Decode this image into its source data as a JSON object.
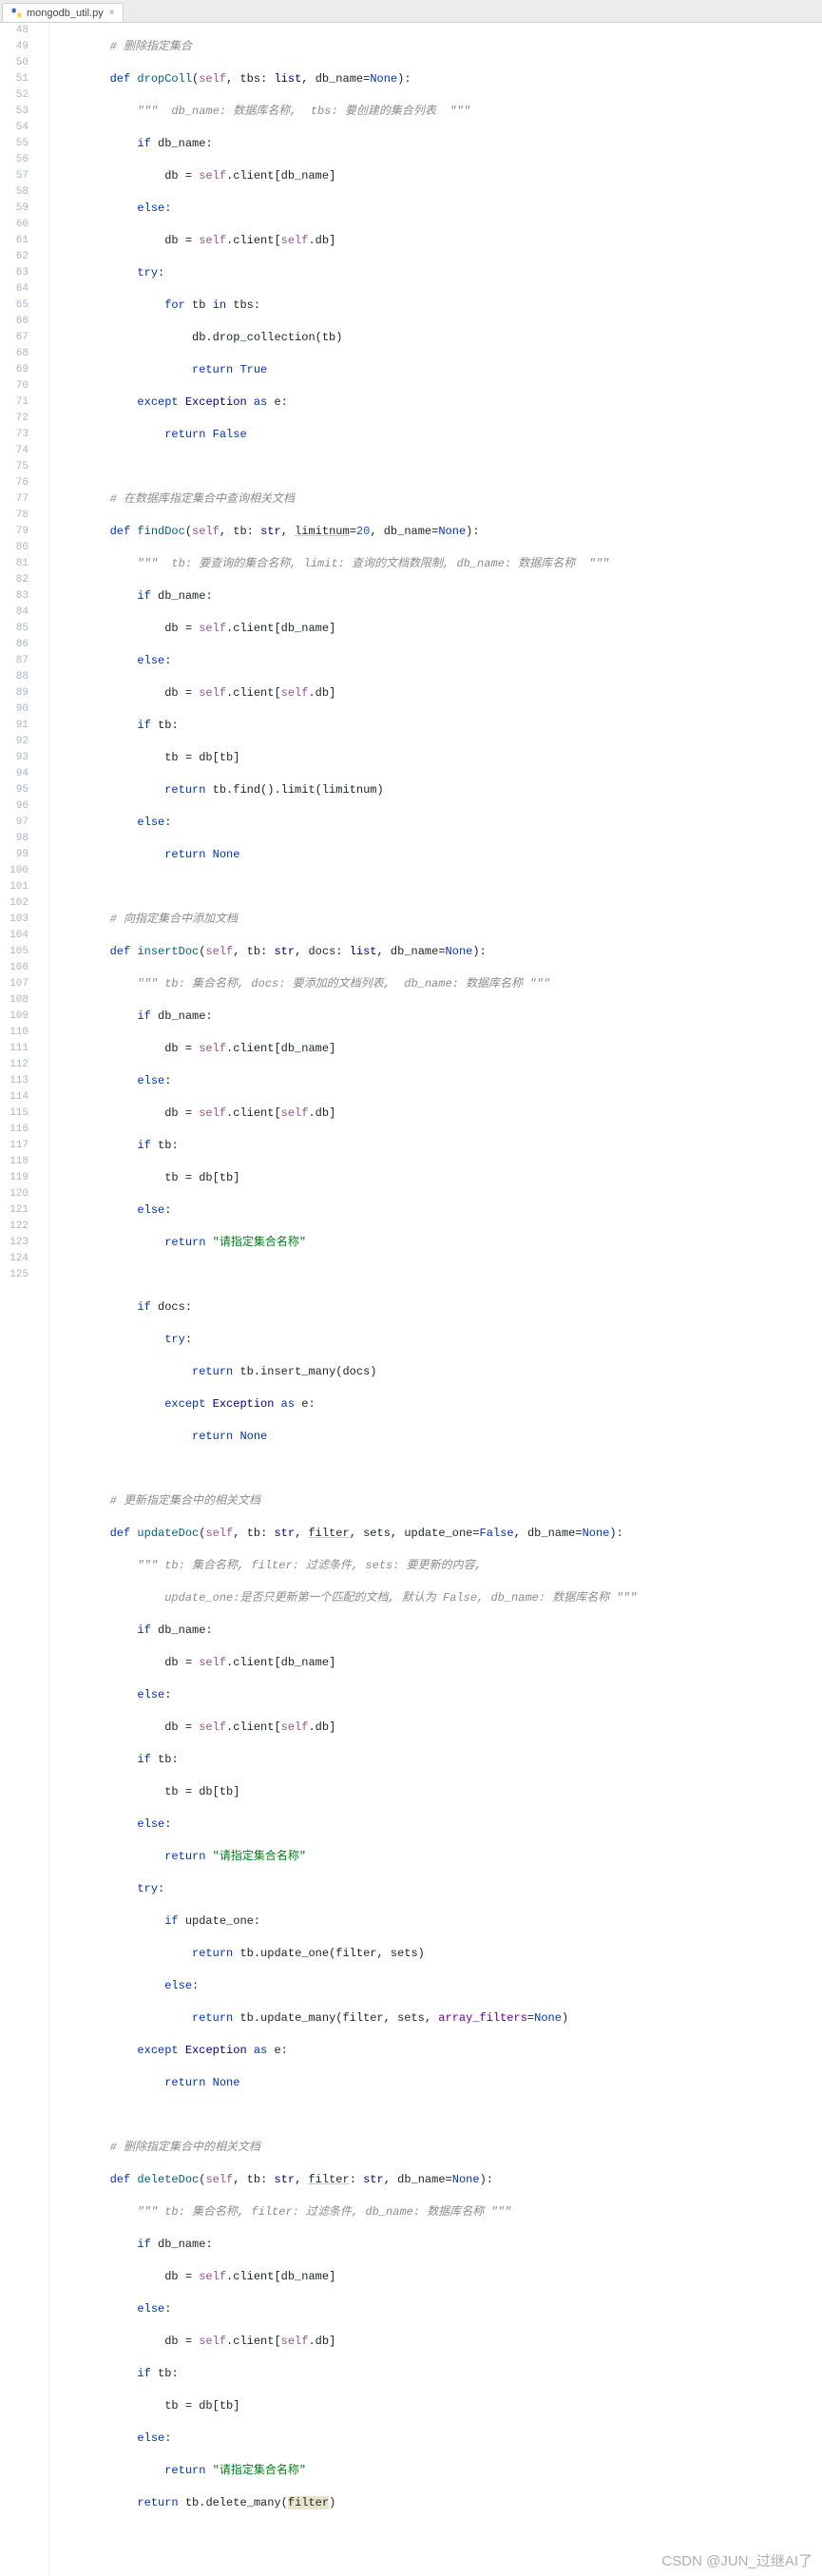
{
  "tab": {
    "filename": "mongodb_util.py",
    "close": "×"
  },
  "gutter": {
    "start": 48,
    "end": 125
  },
  "watermark": "CSDN @JUN_过继AI了",
  "code": {
    "l48": {
      "comment": "# 删除指定集合"
    },
    "l49": {
      "kw1": "def",
      "name": "dropColl",
      "self": "self",
      "p1": "tbs",
      "t1": "list",
      "p2": "db_name",
      "none": "None"
    },
    "l50": {
      "doc": "\"\"\"  db_name: 数据库名称,  tbs: 要创建的集合列表  \"\"\""
    },
    "l51": {
      "kw": "if",
      "id": "db_name"
    },
    "l52": {
      "id1": "db",
      "self": "self",
      "id2": ".client[db_name]"
    },
    "l53": {
      "kw": "else"
    },
    "l54": {
      "id1": "db",
      "self1": "self",
      "mid": ".client[",
      "self2": "self",
      "end": ".db]"
    },
    "l55": {
      "kw": "try"
    },
    "l56": {
      "kw1": "for",
      "id": "tb",
      "kw2": "in",
      "id2": "tbs"
    },
    "l57": {
      "txt": "db.drop_collection(tb)"
    },
    "l58": {
      "kw": "return",
      "val": "True"
    },
    "l59": {
      "kw1": "except",
      "exc": "Exception",
      "kw2": "as",
      "id": "e"
    },
    "l60": {
      "kw": "return",
      "val": "False"
    },
    "l62": {
      "comment": "# 在数据库指定集合中查询相关文档"
    },
    "l63": {
      "kw": "def",
      "name": "findDoc",
      "self": "self",
      "p1": "tb",
      "t1": "str",
      "p2": "limitnum",
      "v2": "20",
      "p3": "db_name",
      "none": "None"
    },
    "l64": {
      "doc": "\"\"\"  tb: 要查询的集合名称, limit: 查询的文档数限制, db_name: 数据库名称  \"\"\""
    },
    "l65": {
      "kw": "if",
      "id": "db_name"
    },
    "l66": {
      "id1": "db",
      "self": "self",
      "rest": ".client[db_name]"
    },
    "l67": {
      "kw": "else"
    },
    "l68": {
      "id1": "db",
      "self1": "self",
      "mid": ".client[",
      "self2": "self",
      "end": ".db]"
    },
    "l69": {
      "kw": "if",
      "id": "tb"
    },
    "l70": {
      "txt": "tb = db[tb]"
    },
    "l71": {
      "kw": "return",
      "txt": "tb.find().limit(limitnum)"
    },
    "l72": {
      "kw": "else"
    },
    "l73": {
      "kw": "return",
      "val": "None"
    },
    "l75": {
      "comment": "# 向指定集合中添加文档"
    },
    "l76": {
      "kw": "def",
      "name": "insertDoc",
      "self": "self",
      "p1": "tb",
      "t1": "str",
      "p2": "docs",
      "t2": "list",
      "p3": "db_name",
      "none": "None"
    },
    "l77": {
      "doc": "\"\"\" tb: 集合名称, docs: 要添加的文档列表,  db_name: 数据库名称 \"\"\""
    },
    "l78": {
      "kw": "if",
      "id": "db_name"
    },
    "l79": {
      "id1": "db",
      "self": "self",
      "rest": ".client[db_name]"
    },
    "l80": {
      "kw": "else"
    },
    "l81": {
      "id1": "db",
      "self1": "self",
      "mid": ".client[",
      "self2": "self",
      "end": ".db]"
    },
    "l82": {
      "kw": "if",
      "id": "tb"
    },
    "l83": {
      "txt": "tb = db[tb]"
    },
    "l84": {
      "kw": "else"
    },
    "l85": {
      "kw": "return",
      "str": "\"请指定集合名称\""
    },
    "l87": {
      "kw": "if",
      "id": "docs"
    },
    "l88": {
      "kw": "try"
    },
    "l89": {
      "kw": "return",
      "txt": "tb.insert_many(docs)"
    },
    "l90": {
      "kw1": "except",
      "exc": "Exception",
      "kw2": "as",
      "id": "e"
    },
    "l91": {
      "kw": "return",
      "val": "None"
    },
    "l93": {
      "comment": "# 更新指定集合中的相关文档"
    },
    "l94": {
      "kw": "def",
      "name": "updateDoc",
      "self": "self",
      "p1": "tb",
      "t1": "str",
      "p2": "filter",
      "p3": "sets",
      "p4": "update_one",
      "v4": "False",
      "p5": "db_name",
      "none": "None"
    },
    "l95": {
      "doc": "\"\"\" tb: 集合名称, filter: 过滤条件, sets: 要更新的内容,"
    },
    "l96": {
      "doc": "    update_one:是否只更新第一个匹配的文档, 默认为 False, db_name: 数据库名称 \"\"\""
    },
    "l97": {
      "kw": "if",
      "id": "db_name"
    },
    "l98": {
      "id1": "db",
      "self": "self",
      "rest": ".client[db_name]"
    },
    "l99": {
      "kw": "else"
    },
    "l100": {
      "id1": "db",
      "self1": "self",
      "mid": ".client[",
      "self2": "self",
      "end": ".db]"
    },
    "l101": {
      "kw": "if",
      "id": "tb"
    },
    "l102": {
      "txt": "tb = db[tb]"
    },
    "l103": {
      "kw": "else"
    },
    "l104": {
      "kw": "return",
      "str": "\"请指定集合名称\""
    },
    "l105": {
      "kw": "try"
    },
    "l106": {
      "kw": "if",
      "id": "update_one"
    },
    "l107": {
      "kw": "return",
      "txt": "tb.update_one(filter, sets)"
    },
    "l108": {
      "kw": "else"
    },
    "l109": {
      "kw": "return",
      "pre": "tb.update_many(filter, sets, ",
      "param": "array_filters",
      "eq": "=",
      "none": "None",
      ")": ")"
    },
    "l110": {
      "kw1": "except",
      "exc": "Exception",
      "kw2": "as",
      "id": "e"
    },
    "l111": {
      "kw": "return",
      "val": "None"
    },
    "l113": {
      "comment": "# 删除指定集合中的相关文档"
    },
    "l114": {
      "kw": "def",
      "name": "deleteDoc",
      "self": "self",
      "p1": "tb",
      "t1": "str",
      "p2": "filter",
      "t2": "str",
      "p3": "db_name",
      "none": "None"
    },
    "l115": {
      "doc": "\"\"\" tb: 集合名称, filter: 过滤条件, db_name: 数据库名称 \"\"\""
    },
    "l116": {
      "kw": "if",
      "id": "db_name"
    },
    "l117": {
      "id1": "db",
      "self": "self",
      "rest": ".client[db_name]"
    },
    "l118": {
      "kw": "else"
    },
    "l119": {
      "id1": "db",
      "self1": "self",
      "mid": ".client[",
      "self2": "self",
      "end": ".db]"
    },
    "l120": {
      "kw": "if",
      "id": "tb"
    },
    "l121": {
      "txt": "tb = db[tb]"
    },
    "l122": {
      "kw": "else"
    },
    "l123": {
      "kw": "return",
      "str": "\"请指定集合名称\""
    },
    "l124": {
      "kw": "return",
      "pre": "tb.delete_many(",
      "hl": "filter",
      "post": ")"
    }
  }
}
